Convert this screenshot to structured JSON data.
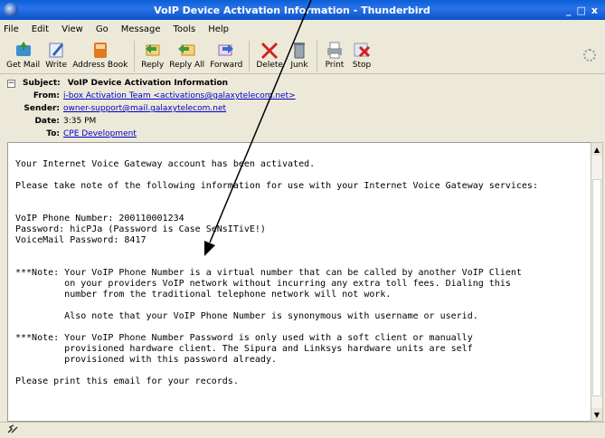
{
  "window": {
    "title": "VoIP Device Activation Information - Thunderbird",
    "controls": [
      "_",
      "□",
      "x"
    ]
  },
  "menu": [
    "File",
    "Edit",
    "View",
    "Go",
    "Message",
    "Tools",
    "Help"
  ],
  "toolbar": {
    "buttons": [
      {
        "label": "Get Mail",
        "icon": "get-mail-icon"
      },
      {
        "label": "Write",
        "icon": "write-icon"
      },
      {
        "label": "Address Book",
        "icon": "address-book-icon"
      },
      {
        "label": "Reply",
        "icon": "reply-icon"
      },
      {
        "label": "Reply All",
        "icon": "reply-all-icon"
      },
      {
        "label": "Forward",
        "icon": "forward-icon"
      },
      {
        "label": "Delete",
        "icon": "delete-icon"
      },
      {
        "label": "Junk",
        "icon": "junk-icon"
      },
      {
        "label": "Print",
        "icon": "print-icon"
      },
      {
        "label": "Stop",
        "icon": "stop-icon"
      }
    ]
  },
  "headers": {
    "subject_label": "Subject:",
    "subject": "VoIP Device Activation Information",
    "from_label": "From:",
    "from": "i-box Activation Team <activations@galaxytelecom.net>",
    "sender_label": "Sender:",
    "sender": "owner-support@mail.galaxytelecom.net",
    "date_label": "Date:",
    "date": "3:35 PM",
    "to_label": "To:",
    "to": "CPE Development"
  },
  "body": {
    "text": "Your Internet Voice Gateway account has been activated.\n\nPlease take note of the following information for use with your Internet Voice Gateway services:\n\n\nVoIP Phone Number: 200110001234\nPassword: hicPJa (Password is Case SeNsITivE!)\nVoiceMail Password: 8417\n\n\n***Note: Your VoIP Phone Number is a virtual number that can be called by another VoIP Client\n         on your providers VoIP network without incurring any extra toll fees. Dialing this\n         number from the traditional telephone network will not work.\n\n         Also note that your VoIP Phone Number is synonymous with username or userid.\n\n***Note: Your VoIP Phone Number Password is only used with a soft client or manually\n         provisioned hardware client. The Sipura and Linksys hardware units are self\n         provisioned with this password already.\n\nPlease print this email for your records."
  },
  "colors": {
    "titlebar": "#0a5fd8",
    "link": "#0000cc",
    "delete": "#d02020"
  }
}
